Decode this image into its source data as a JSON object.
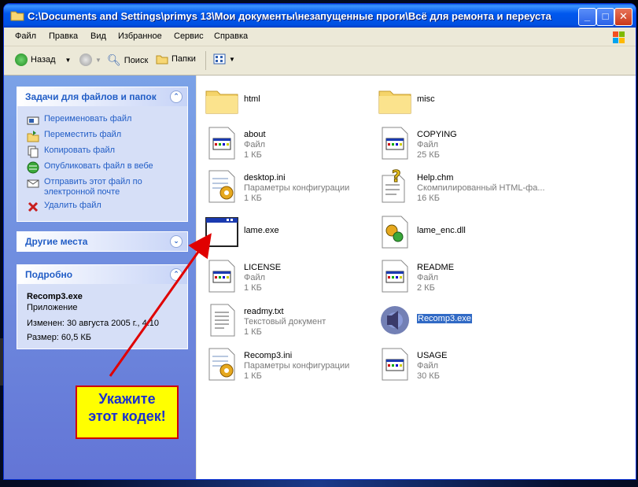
{
  "window": {
    "title": "C:\\Documents and Settings\\primys 13\\Мои документы\\незапущенные проги\\Всё для ремонта и переуста",
    "minimize": "_",
    "maximize": "□",
    "close": "✕"
  },
  "menu": [
    "Файл",
    "Правка",
    "Вид",
    "Избранное",
    "Сервис",
    "Справка"
  ],
  "toolbar": {
    "back": "Назад",
    "search": "Поиск",
    "folders": "Папки"
  },
  "side": {
    "tasks_title": "Задачи для файлов и папок",
    "tasks": [
      "Переименовать файл",
      "Переместить файл",
      "Копировать файл",
      "Опубликовать файл в вебе",
      "Отправить этот файл по",
      "электронной почте",
      "Удалить файл"
    ],
    "other_title": "Другие места",
    "details_title": "Подробно",
    "details": {
      "name": "Recomp3.exe",
      "type": "Приложение",
      "modified": "Изменен: 30 августа 2005 г., 4:10",
      "size": "Размер: 60,5 КБ"
    }
  },
  "files": [
    {
      "name": "html",
      "l1": "",
      "l2": ""
    },
    {
      "name": "misc",
      "l1": "",
      "l2": ""
    },
    {
      "name": "about",
      "l1": "Файл",
      "l2": "1 КБ"
    },
    {
      "name": "COPYING",
      "l1": "Файл",
      "l2": "25 КБ"
    },
    {
      "name": "desktop.ini",
      "l1": "Параметры конфигурации",
      "l2": "1 КБ"
    },
    {
      "name": "Help.chm",
      "l1": "Скомпилированный HTML-фа...",
      "l2": "16 КБ"
    },
    {
      "name": "lame.exe",
      "l1": "",
      "l2": ""
    },
    {
      "name": "lame_enc.dll",
      "l1": "",
      "l2": ""
    },
    {
      "name": "LICENSE",
      "l1": "Файл",
      "l2": "1 КБ"
    },
    {
      "name": "README",
      "l1": "Файл",
      "l2": "2 КБ"
    },
    {
      "name": "readmy.txt",
      "l1": "Текстовый документ",
      "l2": "1 КБ"
    },
    {
      "name": "Recomp3.exe",
      "l1": "",
      "l2": ""
    },
    {
      "name": "Recomp3.ini",
      "l1": "Параметры конфигурации",
      "l2": "1 КБ"
    },
    {
      "name": "USAGE",
      "l1": "Файл",
      "l2": "30 КБ"
    }
  ],
  "callout": {
    "line1": "Укажите",
    "line2": "этот кодек!"
  },
  "colors": {
    "titlebar": "#0058ee",
    "sidebar": "#6f8fe0",
    "link": "#215dc6",
    "callout_bg": "#ffff00",
    "callout_border": "#d00000",
    "callout_text": "#1a30d0",
    "arrow": "#e00000"
  }
}
